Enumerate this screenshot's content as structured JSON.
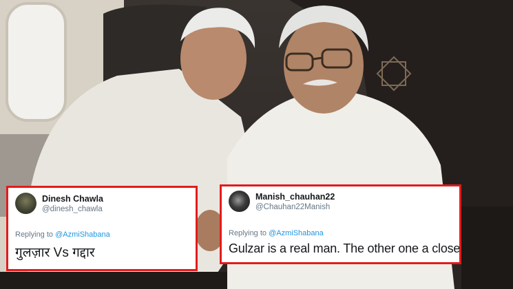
{
  "tweets": [
    {
      "display_name": "Dinesh Chawla",
      "handle": "@dinesh_chawla",
      "replying_prefix": "Replying to ",
      "replying_to": "@AzmiShabana",
      "text": "गुलज़ार Vs गद्दार",
      "avatar": "user-avatar-photo"
    },
    {
      "display_name": "Manish_chauhan22",
      "handle": "@Chauhan22Manish",
      "replying_prefix": "Replying to ",
      "replying_to": "@AzmiShabana",
      "text": "Gulzar is a real man. The other one a closet jehadi",
      "avatar": "user-avatar-dark"
    }
  ],
  "colors": {
    "highlight_border": "#e31b1b",
    "mention": "#1b95e0",
    "secondary_text": "#657786",
    "primary_text": "#14171a"
  }
}
